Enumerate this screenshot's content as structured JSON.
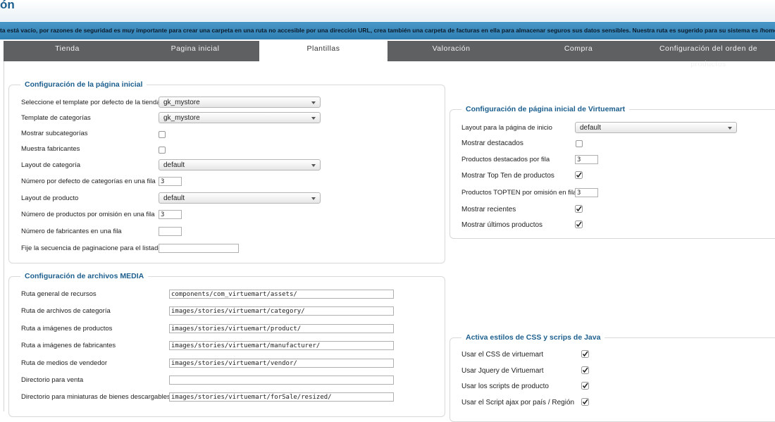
{
  "page_title": "ón",
  "warning": "ta está vacío, por razones de seguridad es muy importante para crear una carpeta en una ruta no accesible por una dirección URL, crea también una carpeta de facturas en ella para almacenar seguros sus datos sensibles. Nuestra ruta es sugerido para su sistema es /home/an",
  "tabs": [
    "Tienda",
    "Pagina inicial",
    "Plantillas",
    "Valoración",
    "Compra",
    "Configuración del orden de productos"
  ],
  "home_config": {
    "legend": "Configuración de la página inicial",
    "default_template_label": "Seleccione el template por defecto de la tienda",
    "default_template_value": "gk_mystore",
    "category_template_label": "Template de categorías",
    "category_template_value": "gk_mystore",
    "show_subcategories_label": "Mostrar subcategorías",
    "show_manufacturers_label": "Muestra fabricantes",
    "category_layout_label": "Layout de categoría",
    "category_layout_value": "default",
    "categories_per_row_label": "Número por defecto de categorías en una fila",
    "categories_per_row_value": "3",
    "product_layout_label": "Layout de producto",
    "product_layout_value": "default",
    "products_per_row_label": "Número de productos por omisión en una fila",
    "products_per_row_value": "3",
    "manufacturers_per_row_label": "Número de fabricantes en una fila",
    "manufacturers_per_row_value": "",
    "pagination_label": "Fije la secuencia de paginacione para el listado",
    "pagination_value": ""
  },
  "media_config": {
    "legend": "Configuración de archivos MEDIA",
    "assets_label": "Ruta general de recursos",
    "assets_value": "components/com_virtuemart/assets/",
    "category_label": "Ruta de archivos de categoría",
    "category_value": "images/stories/virtuemart/category/",
    "product_label": "Ruta a imágenes de productos",
    "product_value": "images/stories/virtuemart/product/",
    "manufacturer_label": "Ruta a imágenes de fabricantes",
    "manufacturer_value": "images/stories/virtuemart/manufacturer/",
    "vendor_label": "Ruta de medios de vendedor",
    "vendor_value": "images/stories/virtuemart/vendor/",
    "forsale_label": "Directorio para venta",
    "forsale_value": "",
    "thumbs_label": "Directorio para miniaturas de bienes descargables",
    "thumbs_value": "images/stories/virtuemart/forSale/resized/"
  },
  "vm_home": {
    "legend": "Configuración de página inicial de Virtuemart",
    "layout_label": "Layout para la página de inicio",
    "layout_value": "default",
    "featured_label": "Mostrar destacados",
    "featured_per_row_label": "Productos destacados por fila",
    "featured_per_row_value": "3",
    "topten_label": "Mostrar Top Ten de productos",
    "topten_per_row_label": "Productos TOPTEN por omisión en fila",
    "topten_per_row_value": "3",
    "recent_label": "Mostrar recientes",
    "latest_label": "Mostrar últimos productos"
  },
  "css_js": {
    "legend": "Activa estilos de CSS y scrips de Java",
    "css_label": "Usar el CSS de virtuemart",
    "jquery_label": "Usar Jquery de Virtuemart",
    "product_scripts_label": "Usar los scripts de producto",
    "ajax_label": "Usar el Script ajax por país / Región"
  },
  "checkbox_states": {
    "show_subcategories": false,
    "show_manufacturers": false,
    "featured": false,
    "topten": true,
    "recent": true,
    "latest": true,
    "css": true,
    "jquery": true,
    "product_scripts": true,
    "ajax": true
  },
  "colors": {
    "accent": "#1c5f8e",
    "warning_bar": "#3a8cc0",
    "tab_bar": "#5f6062"
  }
}
